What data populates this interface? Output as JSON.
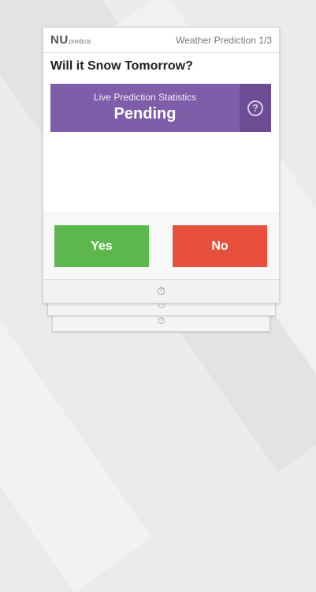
{
  "app": {
    "logo_main": "NU",
    "logo_sub": "predicts",
    "header_title": "Weather Prediction 1/3"
  },
  "question": "Will it Snow Tomorrow?",
  "stats": {
    "label": "Live Prediction Statistics",
    "value": "Pending",
    "help_icon": "question-circle-icon",
    "help_glyph": "?"
  },
  "answers": {
    "yes_label": "Yes",
    "no_label": "No",
    "yes_color": "#5cb84c",
    "no_color": "#e8503e"
  },
  "footer": {
    "timer_icon": "stopwatch-icon",
    "timer_glyph": "⏱"
  },
  "colors": {
    "accent_purple": "#7e5ea8"
  }
}
